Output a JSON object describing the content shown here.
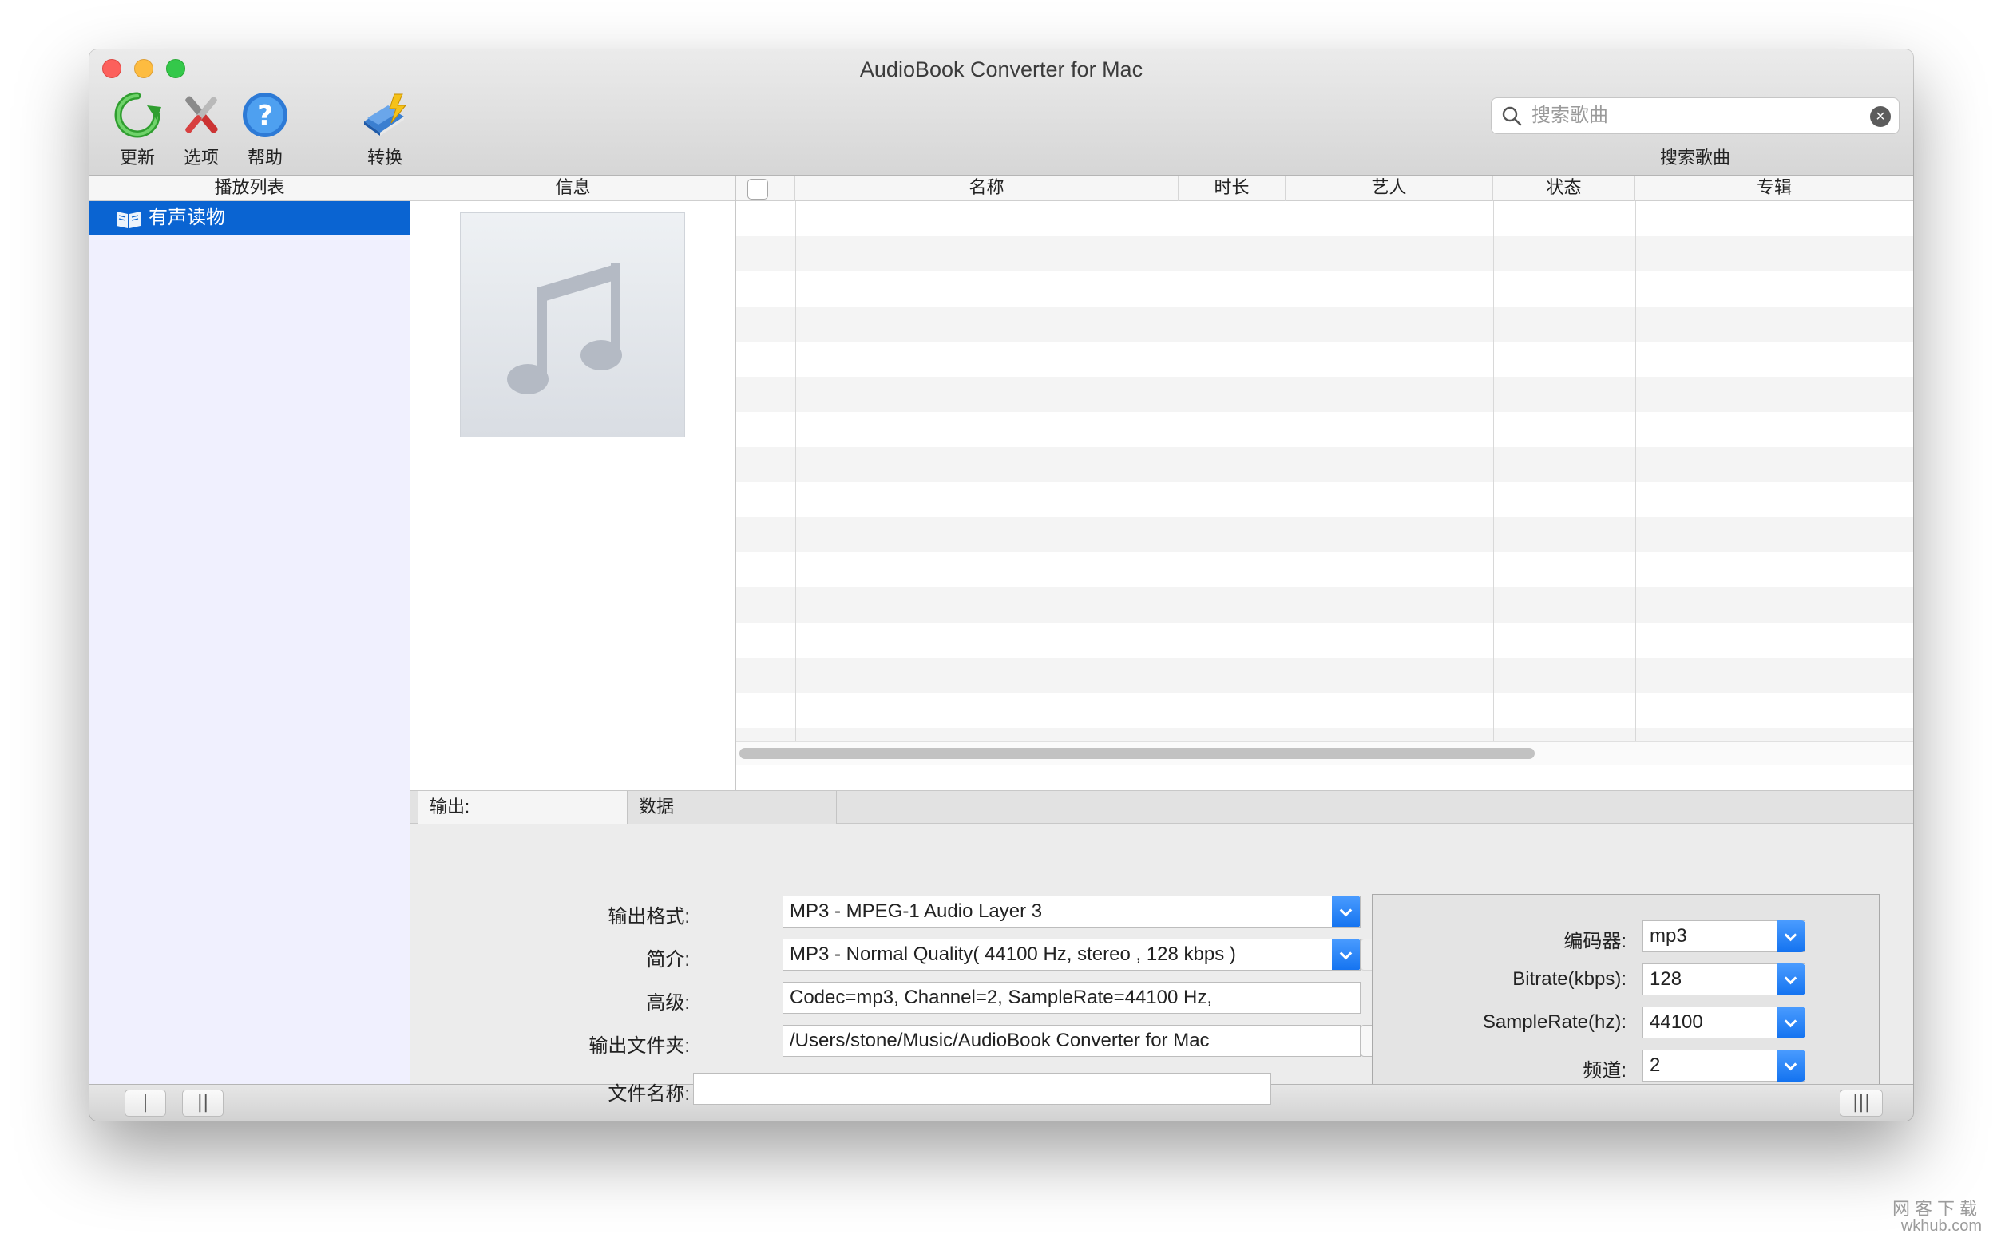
{
  "window": {
    "title": "AudioBook Converter for Mac"
  },
  "toolbar": {
    "refresh_label": "更新",
    "options_label": "选项",
    "help_label": "帮助",
    "convert_label": "转换"
  },
  "search": {
    "placeholder": "搜索歌曲",
    "caption": "搜索歌曲"
  },
  "sidebar": {
    "header": "播放列表",
    "items": [
      {
        "label": "有声读物",
        "icon": "book-icon",
        "selected": true
      }
    ]
  },
  "info": {
    "header": "信息",
    "artwork_icon": "music-note-icon"
  },
  "table": {
    "columns": [
      "名称",
      "时长",
      "艺人",
      "状态",
      "专辑"
    ],
    "rows": []
  },
  "tabs": {
    "output_label": "输出:",
    "data_label": "数据"
  },
  "output": {
    "format_label": "输出格式:",
    "format_value": "MP3 - MPEG-1 Audio Layer 3",
    "profile_label": "简介:",
    "profile_value": "MP3 - Normal Quality( 44100 Hz, stereo , 128 kbps )",
    "profile_minus": "-",
    "advanced_label": "高级:",
    "advanced_value": "Codec=mp3, Channel=2, SampleRate=44100 Hz,",
    "folder_label": "输出文件夹:",
    "folder_value": "/Users/stone/Music/AudioBook Converter for Mac",
    "browse_label": "...",
    "filename_label": "文件名称:",
    "filename_value": ""
  },
  "codec": {
    "encoder_label": "编码器:",
    "encoder_value": "mp3",
    "bitrate_label": "Bitrate(kbps):",
    "bitrate_value": "128",
    "samplerate_label": "SampleRate(hz):",
    "samplerate_value": "44100",
    "channel_label": "频道:",
    "channel_value": "2"
  },
  "bottombar": {
    "btn1": "|",
    "btn2": "||",
    "btn3": "|||"
  },
  "watermark": {
    "line1": "网客下载",
    "line2": "wkhub.com"
  },
  "colors": {
    "accent": "#0a64d2",
    "select_arrow": "#1473f0"
  }
}
